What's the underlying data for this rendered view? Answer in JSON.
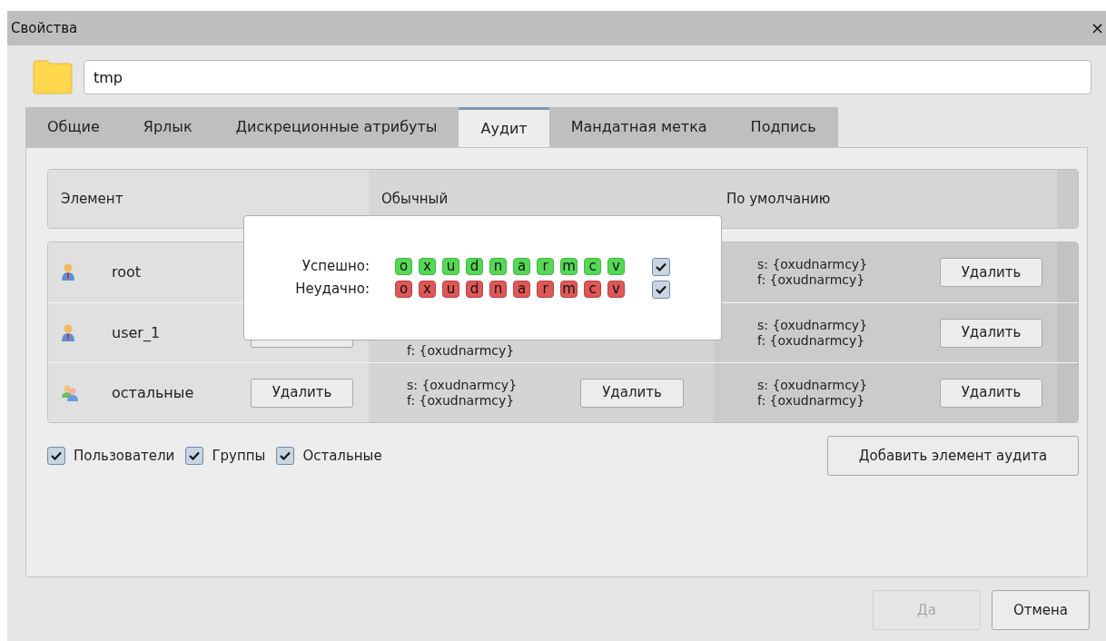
{
  "window": {
    "title": "Свойства",
    "close": "×"
  },
  "name_field": {
    "value": "tmp"
  },
  "tabs": [
    {
      "label": "Общие",
      "selected": false
    },
    {
      "label": "Ярлык",
      "selected": false
    },
    {
      "label": "Дискреционные атрибуты",
      "selected": false
    },
    {
      "label": "Аудит",
      "selected": true
    },
    {
      "label": "Мандатная метка",
      "selected": false
    },
    {
      "label": "Подпись",
      "selected": false
    }
  ],
  "table": {
    "columns": [
      "Элемент",
      "Обычный",
      "По умолчанию"
    ],
    "rows": [
      {
        "kind": "user",
        "name": "root",
        "element_button": "",
        "normal": [],
        "normal_button": "",
        "default": [
          "s: {oxudnarmcy}",
          "f: {oxudnarmcy}"
        ],
        "default_button": "Удалить"
      },
      {
        "kind": "user",
        "name": "user_1",
        "element_button": "",
        "normal": [
          "f: {oxudnarmcy}"
        ],
        "normal_button": "",
        "default": [
          "s: {oxudnarmcy}",
          "f: {oxudnarmcy}"
        ],
        "default_button": "Удалить"
      },
      {
        "kind": "group",
        "name": "остальные",
        "element_button": "Удалить",
        "normal": [
          "s: {oxudnarmcy}",
          "f: {oxudnarmcy}"
        ],
        "normal_button": "Удалить",
        "default": [
          "s: {oxudnarmcy}",
          "f: {oxudnarmcy}"
        ],
        "default_button": "Удалить"
      }
    ]
  },
  "popup": {
    "rows": [
      {
        "kind": "success",
        "label": "Успешно:",
        "flags": [
          "o",
          "x",
          "u",
          "d",
          "n",
          "a",
          "r",
          "m",
          "c",
          "v"
        ],
        "checked": true
      },
      {
        "kind": "failure",
        "label": "Неудачно:",
        "flags": [
          "o",
          "x",
          "u",
          "d",
          "n",
          "a",
          "r",
          "m",
          "c",
          "v"
        ],
        "checked": true
      }
    ]
  },
  "filters": [
    {
      "label": "Пользователи",
      "checked": true
    },
    {
      "label": "Группы",
      "checked": true
    },
    {
      "label": "Остальные",
      "checked": true
    }
  ],
  "add_button": "Добавить элемент аудита",
  "buttons": [
    {
      "label": "Да",
      "disabled": true
    },
    {
      "label": "Отмена",
      "disabled": false
    }
  ]
}
